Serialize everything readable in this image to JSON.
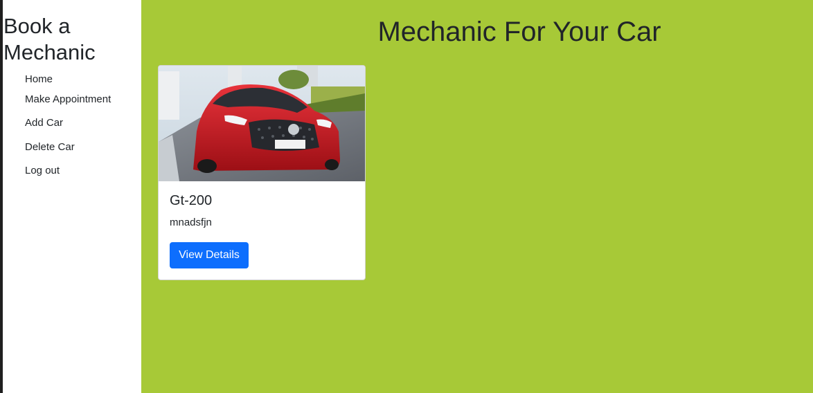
{
  "sidebar": {
    "brand": "Book a Mechanic",
    "items": [
      {
        "label": "Home"
      },
      {
        "label": "Make Appointment"
      },
      {
        "label": "Add Car"
      },
      {
        "label": "Delete Car"
      },
      {
        "label": "Log out"
      }
    ]
  },
  "main": {
    "title": "Mechanic For Your Car",
    "cards": [
      {
        "title": "Gt-200",
        "description": "mnadsfjn",
        "button_label": "View Details"
      }
    ]
  },
  "colors": {
    "main_background": "#a7c937",
    "primary_button": "#0d6efd",
    "car_body": "#c8141c"
  }
}
